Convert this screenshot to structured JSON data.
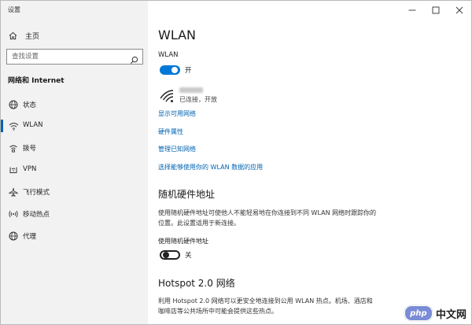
{
  "window": {
    "title": "设置"
  },
  "sidebar": {
    "home": "主页",
    "search_placeholder": "查找设置",
    "section_title": "网络和 Internet",
    "items": [
      {
        "label": "状态",
        "icon": "globe-icon"
      },
      {
        "label": "WLAN",
        "icon": "wifi-icon",
        "active": true
      },
      {
        "label": "拨号",
        "icon": "dialup-icon"
      },
      {
        "label": "VPN",
        "icon": "vpn-icon"
      },
      {
        "label": "飞行模式",
        "icon": "airplane-icon"
      },
      {
        "label": "移动热点",
        "icon": "hotspot-icon"
      },
      {
        "label": "代理",
        "icon": "globe-icon"
      }
    ]
  },
  "main": {
    "title": "WLAN",
    "wlan_toggle": {
      "label": "WLAN",
      "state": "开",
      "on": true
    },
    "network": {
      "status": "已连接，开放"
    },
    "links": [
      "显示可用网络",
      "硬件属性",
      "管理已知网络",
      "选择能够使用你的 WLAN 数据的应用"
    ],
    "random_hw": {
      "title": "随机硬件地址",
      "description": "使用随机硬件地址可使他人不能轻易地在你连接到不同 WLAN 网络时跟踪你的位置。此设置适用于新连接。",
      "toggle_label": "使用随机硬件地址",
      "state": "关",
      "on": false
    },
    "hotspot20": {
      "title": "Hotspot 2.0 网络",
      "description": "利用 Hotspot 2.0 网络可以更安全地连接到公用 WLAN 热点。机场、酒店和咖啡店等公共场所中可能会提供这些热点。"
    }
  },
  "watermark": {
    "badge": "php",
    "text": "中文网"
  },
  "colors": {
    "accent": "#0078d7",
    "link": "#0063b1",
    "sidebar_bg": "#f2f2f2"
  }
}
